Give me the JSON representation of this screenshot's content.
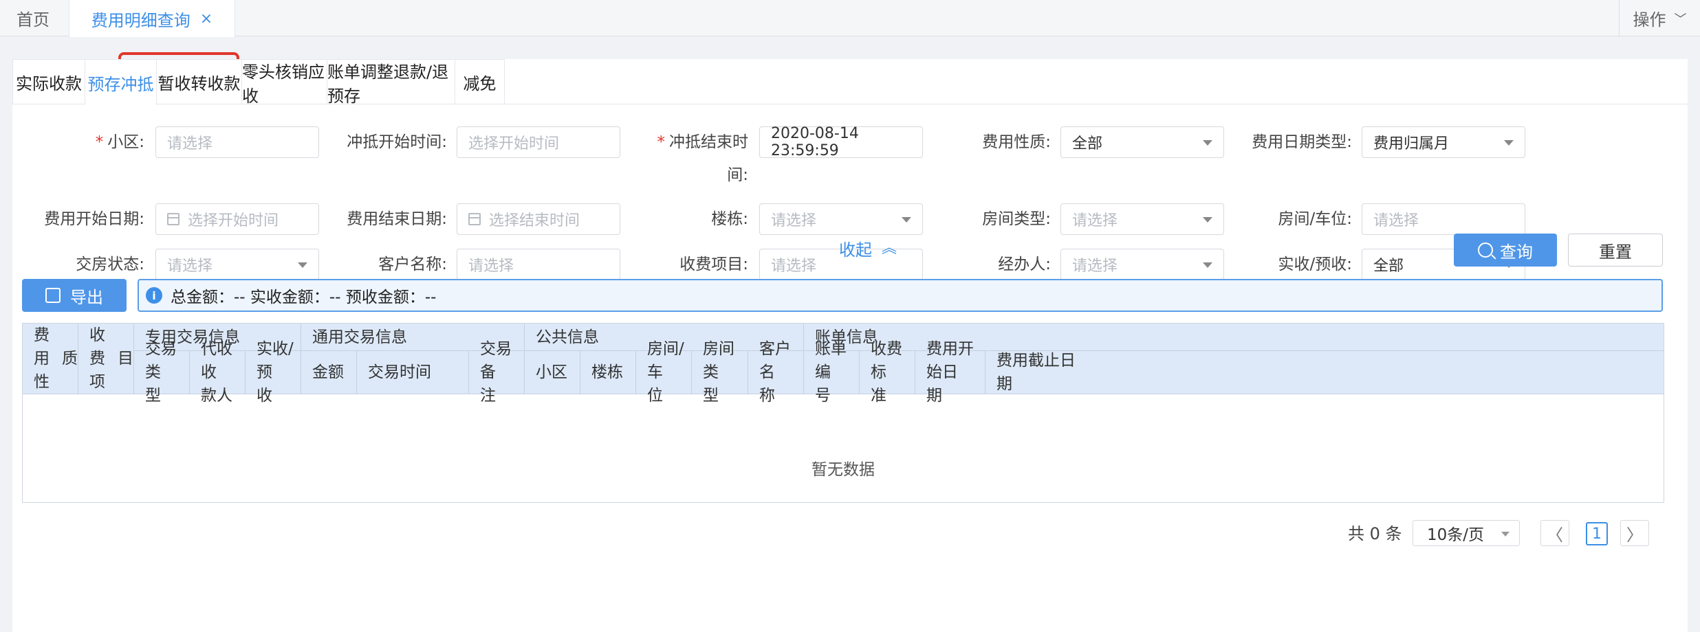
{
  "topbar": {
    "home": "首页",
    "active_tab": "费用明细查询",
    "close": "×",
    "op": "操作",
    "op_chevron": "﹀"
  },
  "subtabs": [
    "实际收款",
    "预存冲抵",
    "暂收转收款",
    "零头核销应收",
    "账单调整退款/退预存",
    "减免"
  ],
  "active_subtab": 1,
  "form": {
    "f1_label": "小区:",
    "f1_placeholder": "请选择",
    "f2_label": "冲抵开始时间:",
    "f2_placeholder": "选择开始时间",
    "f3_label_1": "冲抵结束时",
    "f3_label_2": "间:",
    "f3_value": "2020-08-14 23:59:59",
    "f4_label": "费用性质:",
    "f4_value": "全部",
    "f5_label": "费用日期类型:",
    "f5_value": "费用归属月",
    "f6_label": "费用开始日期:",
    "f6_placeholder": "选择开始时间",
    "f7_label": "费用结束日期:",
    "f7_placeholder": "选择结束时间",
    "f8_label": "楼栋:",
    "f8_placeholder": "请选择",
    "f9_label": "房间类型:",
    "f9_placeholder": "请选择",
    "f10_label": "房间/车位:",
    "f10_placeholder": "请选择",
    "f11_label": "交房状态:",
    "f11_placeholder": "请选择",
    "f12_label": "客户名称:",
    "f12_placeholder": "请选择",
    "f13_label": "收费项目:",
    "f13_placeholder": "请选择",
    "f14_label": "经办人:",
    "f14_placeholder": "请选择",
    "f15_label": "实收/预收:",
    "f15_value": "全部",
    "required_mark": "*"
  },
  "actions": {
    "collapse": "收起",
    "collapse_icon": "︽",
    "query": "查询",
    "reset": "重置",
    "export": "导出"
  },
  "summary": {
    "info_icon": "i",
    "text": "总金额：-- 实收金额：-- 预收金额：--"
  },
  "table": {
    "group_headers": [
      "专用交易信息",
      "通用交易信息",
      "公共信息",
      "账单信息"
    ],
    "h_fee_nature": [
      "费用性",
      "质"
    ],
    "h_charge_item": [
      "收费项",
      "目"
    ],
    "sub_headers": [
      [
        "交易类",
        "型"
      ],
      [
        "代收收",
        "款人"
      ],
      [
        "实收/预",
        "收"
      ],
      [
        "金额",
        ""
      ],
      [
        "交易时间",
        ""
      ],
      [
        "交易备",
        "注"
      ],
      [
        "小区",
        ""
      ],
      [
        "楼栋",
        ""
      ],
      [
        "房间/车",
        "位"
      ],
      [
        "房间类",
        "型"
      ],
      [
        "客户名",
        "称"
      ],
      [
        "账单编",
        "号"
      ],
      [
        "收费标",
        "准"
      ],
      [
        "费用开始日",
        "期"
      ],
      [
        "费用截止日",
        "期"
      ]
    ],
    "empty": "暂无数据"
  },
  "pager": {
    "total": "共 0 条",
    "page_size": "10条/页",
    "prev": "〈",
    "next": "〉",
    "current": "1"
  }
}
